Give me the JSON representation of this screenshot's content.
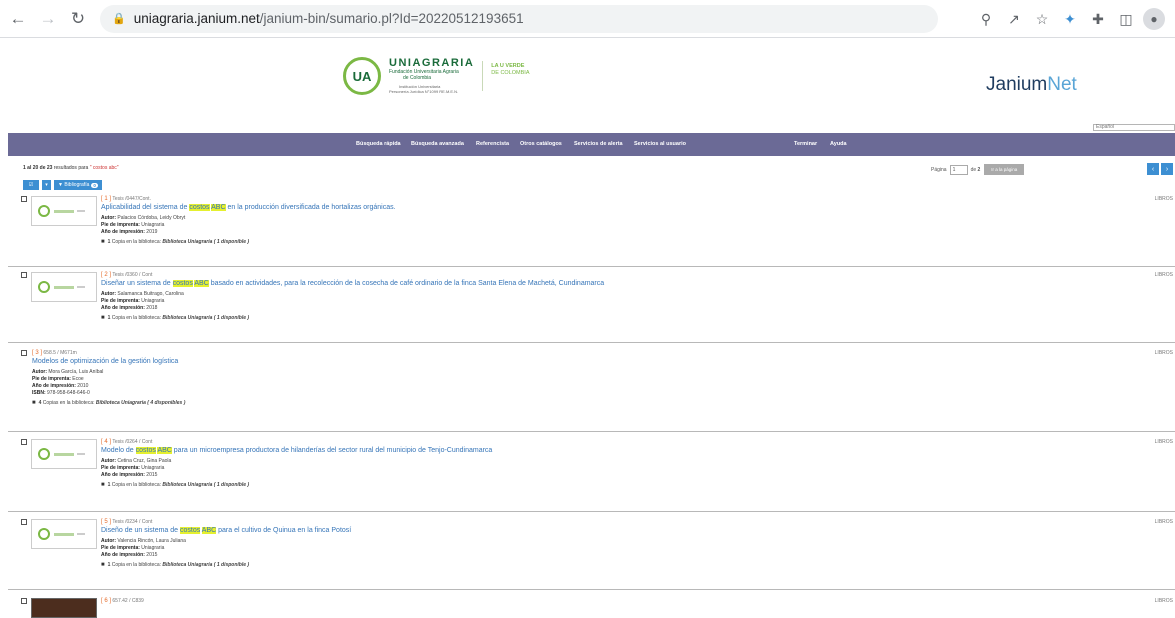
{
  "browser": {
    "url_host": "uniagraria.janium.net",
    "url_path": "/janium-bin/sumario.pl?Id=20220512193651"
  },
  "header": {
    "ua_initials": "UA",
    "ua_name": "UNIAGRARIA",
    "ua_sub1": "Fundación Universitaria Agraria",
    "ua_sub2": "de Colombia",
    "ua_sub3": "Institución Universitaria",
    "ua_sub4": "Personería Jurídica N°1099 RE.M.E.N.",
    "ua_verde1": "LA U VERDE",
    "ua_verde2": "DE COLOMBIA",
    "janium_a": "Janium",
    "janium_b": "Net",
    "lang": "Español"
  },
  "nav": {
    "items": [
      "Búsqueda rápida",
      "Búsqueda avanzada",
      "Referencista",
      "Otros catálogos",
      "Servicios de alerta",
      "Servicios al usuario",
      "Terminar",
      "Ayuda"
    ]
  },
  "results": {
    "range": "1 al 20 de 23",
    "label": "resultados para",
    "query": "\" costos abc\"",
    "page_label": "Página",
    "page_value": "1",
    "page_of": "de",
    "page_total": "2",
    "go_label": "Ir a la página",
    "bib_label": "Bibliografía",
    "bib_count": "0"
  },
  "records": [
    {
      "num": "[ 1 ]",
      "ref": "Tesis /0447/Cont.",
      "title_pre": "Aplicabilidad del sistema de ",
      "hl1": "costos",
      "hl_sep": " ",
      "hl2": "ABC",
      "title_post": " en la producción diversificada de hortalizas orgánicas.",
      "m1_label": "Autor:",
      "m1_value": "Palacios Córdoba, Leidy Obryt",
      "m2_label": "Pie de imprenta:",
      "m2_value": "Uniagraria",
      "m3_label": "Año de impresión:",
      "m3_value": "2019",
      "copies_n": "1",
      "copies_text": "Copia en la biblioteca:",
      "copies_lib": "Biblioteca Uniagraria ( 1 disponible )",
      "type": "LIBROS"
    },
    {
      "num": "[ 2 ]",
      "ref": "Tesis /0360 / Cont",
      "title_pre": "Diseñar un sistema de ",
      "hl1": "costos",
      "hl_sep": " ",
      "hl2": "ABC",
      "title_post": " basado en actividades, para la recolección de la cosecha de café ordinario de la finca Santa Elena de Machetá, Cundinamarca",
      "m1_label": "Autor:",
      "m1_value": "Salamanca Buitrago, Carolina",
      "m2_label": "Pie de imprenta:",
      "m2_value": "Uniagraria",
      "m3_label": "Año de impresión:",
      "m3_value": "2018",
      "copies_n": "1",
      "copies_text": "Copia en la biblioteca:",
      "copies_lib": "Biblioteca Uniagraria ( 1 disponible )",
      "type": "LIBROS"
    },
    {
      "num": "[ 3 ]",
      "ref": "658.5 / M671m",
      "title": "Modelos de optimización de la gestión logística",
      "m1_label": "Autor:",
      "m1_value": "Mora García, Luis Aníbal",
      "m2_label": "Pie de imprenta:",
      "m2_value": "Ecoe",
      "m3_label": "Año de impresión:",
      "m3_value": "2010",
      "m4_label": "ISBN:",
      "m4_value": "978-958-648-646-0",
      "copies_n": "4",
      "copies_text": "Copias en la biblioteca:",
      "copies_lib": "Biblioteca Uniagraria ( 4 disponibles )",
      "type": "LIBROS"
    },
    {
      "num": "[ 4 ]",
      "ref": "Tesis /0264 / Cont",
      "title_pre": "Modelo de ",
      "hl1": "costos",
      "hl_sep": " ",
      "hl2": "ABC",
      "title_post": " para un microempresa productora de hilanderías del sector rural del municipio de Tenjo-Cundinamarca",
      "m1_label": "Autor:",
      "m1_value": "Cetina Cruz, Gina Paola",
      "m2_label": "Pie de imprenta:",
      "m2_value": "Uniagraria",
      "m3_label": "Año de impresión:",
      "m3_value": "2015",
      "copies_n": "1",
      "copies_text": "Copia en la biblioteca:",
      "copies_lib": "Biblioteca Uniagraria ( 1 disponible )",
      "type": "LIBROS"
    },
    {
      "num": "[ 5 ]",
      "ref": "Tesis /0234 / Cont",
      "title_pre": "Diseño de un sistema de ",
      "hl1": "costos",
      "hl_sep": " ",
      "hl2": "ABC",
      "title_post": " para el cultivo de Quinua en la finca Potosí",
      "m1_label": "Autor:",
      "m1_value": "Valencia Rincón, Laura Juliana",
      "m2_label": "Pie de imprenta:",
      "m2_value": "Uniagraria",
      "m3_label": "Año de impresión:",
      "m3_value": "2015",
      "copies_n": "1",
      "copies_text": "Copia en la biblioteca:",
      "copies_lib": "Biblioteca Uniagraria ( 1 disponible )",
      "type": "LIBROS"
    },
    {
      "num": "[ 6 ]",
      "ref": "657.42 / C839",
      "type": "LIBROS"
    }
  ]
}
